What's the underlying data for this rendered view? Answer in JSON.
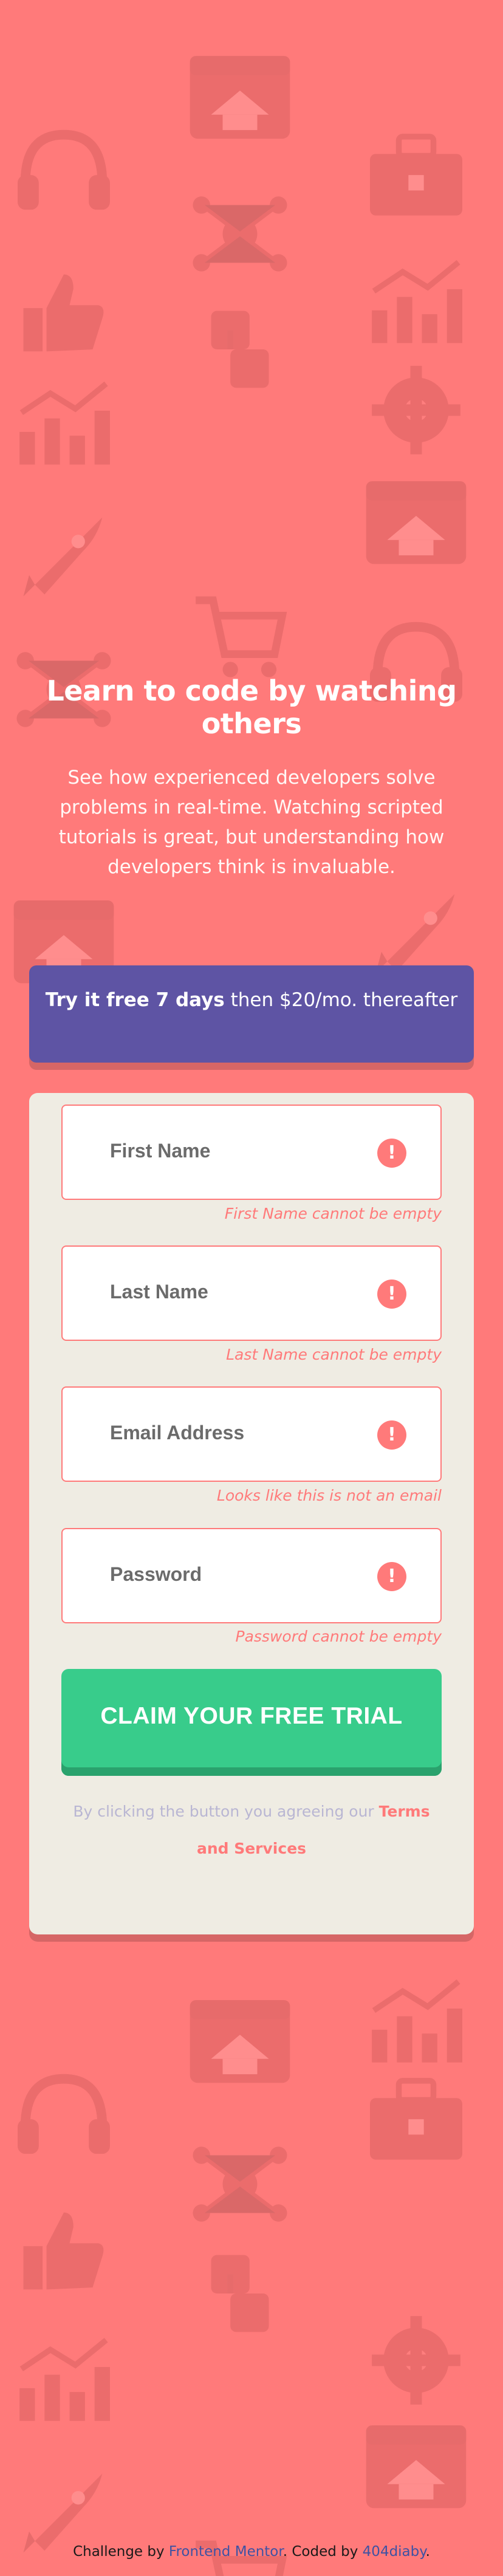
{
  "hero": {
    "title": "Learn to code by watching others",
    "description": "See how experienced developers solve problems in real-time. Watching scripted tutorials is great, but understanding how developers think is invaluable."
  },
  "offer": {
    "highlight": "Try it free 7 days",
    "rest": " then $20/mo. thereafter"
  },
  "form": {
    "fields": [
      {
        "placeholder": "First Name",
        "error": "First Name cannot be empty"
      },
      {
        "placeholder": "Last Name",
        "error": "Last Name cannot be empty"
      },
      {
        "placeholder": "Email Address",
        "error": "Looks like this is not an email"
      },
      {
        "placeholder": "Password",
        "error": "Password cannot be empty"
      }
    ],
    "error_icon_glyph": "!",
    "submit_label": "CLAIM YOUR FREE TRIAL",
    "terms_prefix": "By clicking the button you agreeing our",
    "terms_link": "Terms and Services"
  },
  "footer": {
    "prefix": "Challenge by",
    "link1": "Frontend Mentor",
    "middle": ". Coded by",
    "link2": "404diaby",
    "suffix": "."
  },
  "colors": {
    "background": "#ff7a7a",
    "offer_bg": "#5e54a4",
    "card_bg": "#efece3",
    "error": "#ff7a7a",
    "cta": "#38cc8b",
    "footer_link": "#3e52a3"
  },
  "background_icons": [
    "browser-window-icon",
    "headset-icon",
    "network-icon",
    "toolbox-icon",
    "puzzle-icon",
    "gear-icon",
    "rocket-icon",
    "thumbs-up-icon",
    "cart-icon",
    "line-chart-icon"
  ]
}
